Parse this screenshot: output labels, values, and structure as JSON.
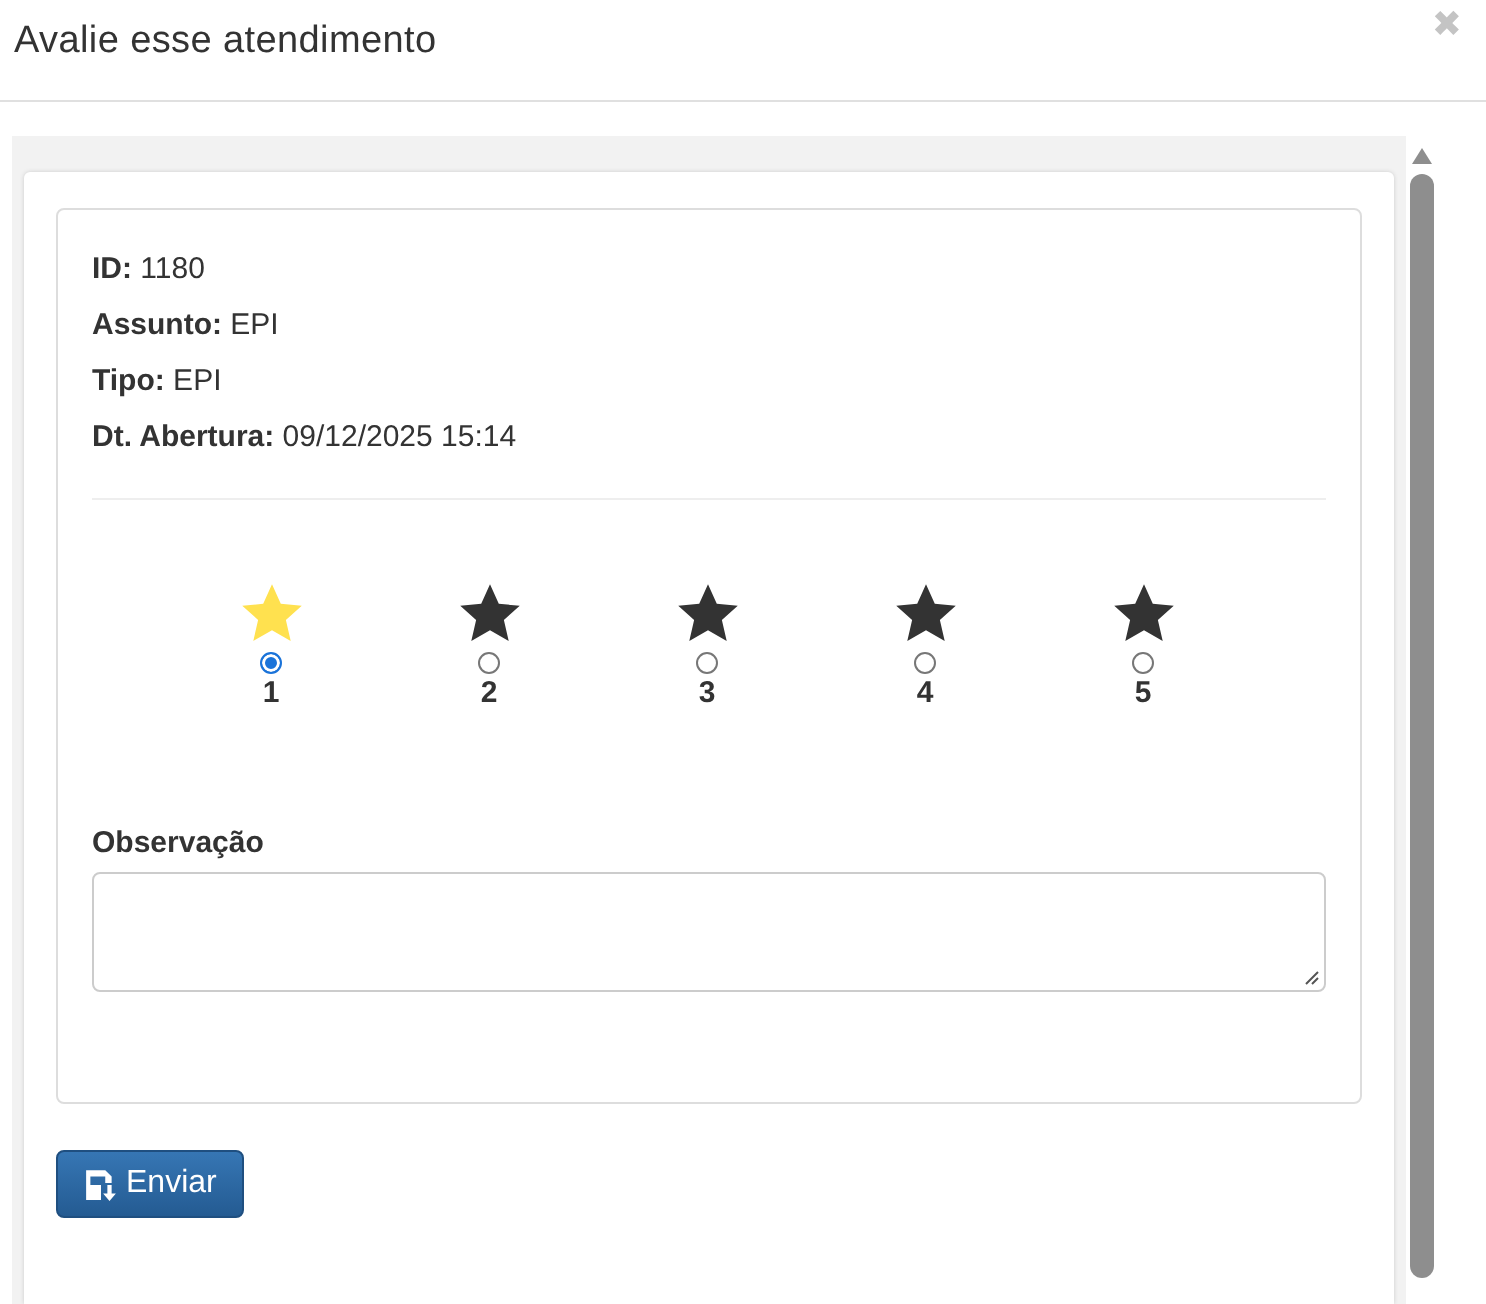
{
  "dialog": {
    "title": "Avalie esse atendimento",
    "close": "✖"
  },
  "details": [
    {
      "label": "ID:",
      "value": "1180"
    },
    {
      "label": "Assunto:",
      "value": "EPI"
    },
    {
      "label": "Tipo:",
      "value": "EPI"
    },
    {
      "label": "Dt. Abertura:",
      "value": "09/12/2025 15:14"
    }
  ],
  "rating": {
    "stars": 1,
    "options": [
      {
        "label": "1",
        "selected": true
      },
      {
        "label": "2",
        "selected": false
      },
      {
        "label": "3",
        "selected": false
      },
      {
        "label": "4",
        "selected": false
      },
      {
        "label": "5",
        "selected": false
      }
    ]
  },
  "observation": {
    "label": "Observação"
  },
  "submit": {
    "label": "Enviar"
  }
}
